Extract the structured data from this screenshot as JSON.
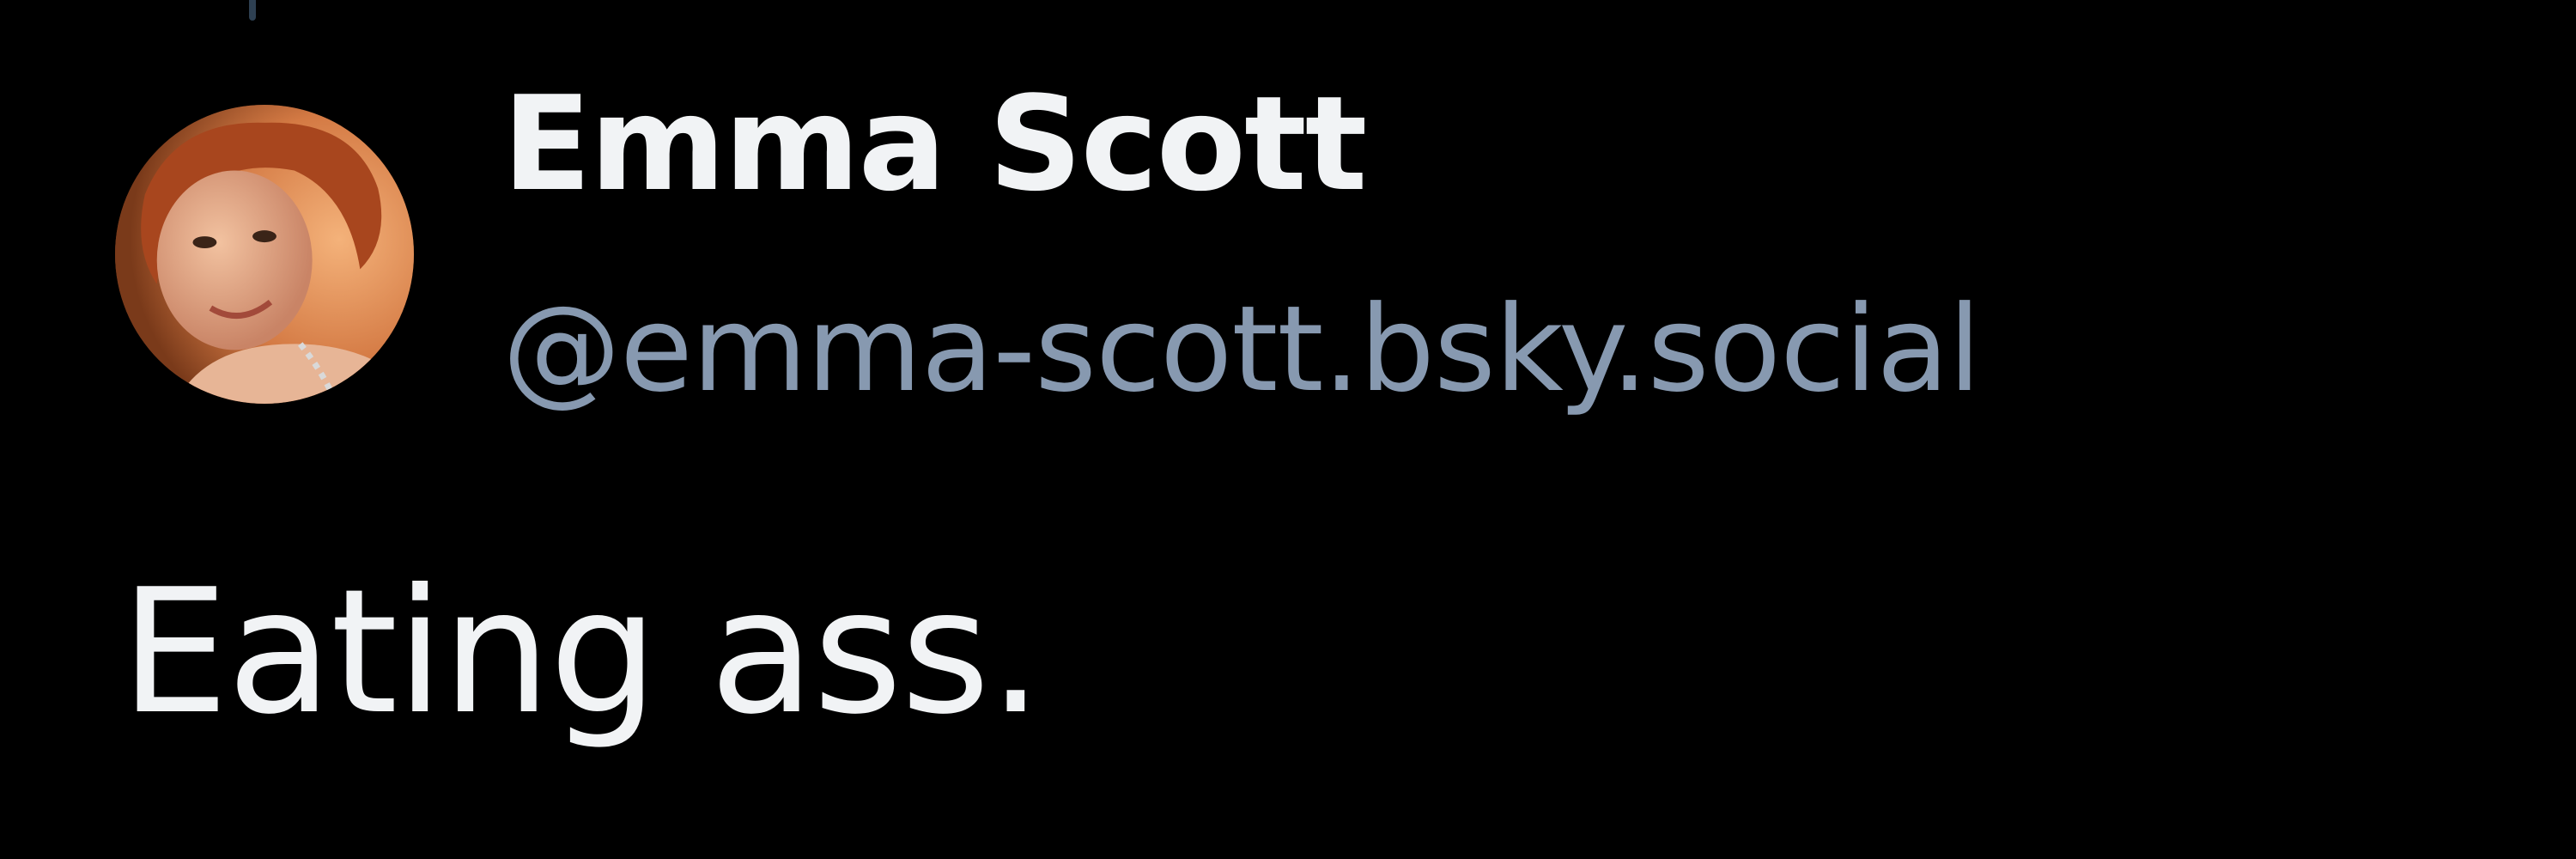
{
  "author": {
    "display_name": "Emma Scott",
    "handle": "@emma-scott.bsky.social",
    "avatar_icon": "user-avatar-photo"
  },
  "post": {
    "text": "Eating ass."
  },
  "colors": {
    "background": "#000000",
    "primary_text": "#f1f3f5",
    "handle_text": "#8799b0",
    "thread_line": "#2e4052"
  }
}
